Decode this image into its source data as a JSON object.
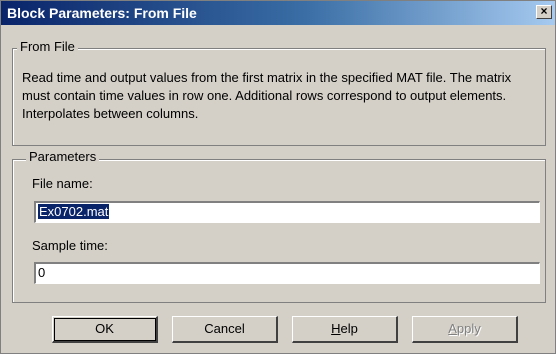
{
  "window": {
    "title": "Block Parameters: From File",
    "close_glyph": "×"
  },
  "block_group": {
    "legend": "From File",
    "description": "Read time and output values from the first matrix in the specified MAT file.  The matrix must contain time values in row one.  Additional rows correspond to output elements.  Interpolates between columns."
  },
  "params_group": {
    "legend": "Parameters",
    "file_name_label": "File name:",
    "file_name_value": "Ex0702.mat",
    "sample_time_label": "Sample time:",
    "sample_time_value": "0"
  },
  "buttons": {
    "ok": "OK",
    "cancel": "Cancel",
    "help_mnemonic": "H",
    "help_rest": "elp",
    "apply_mnemonic": "A",
    "apply_rest": "pply"
  },
  "colors": {
    "title_active": "#0a246a",
    "face": "#d4d0c8",
    "selection": "#0a246a"
  }
}
